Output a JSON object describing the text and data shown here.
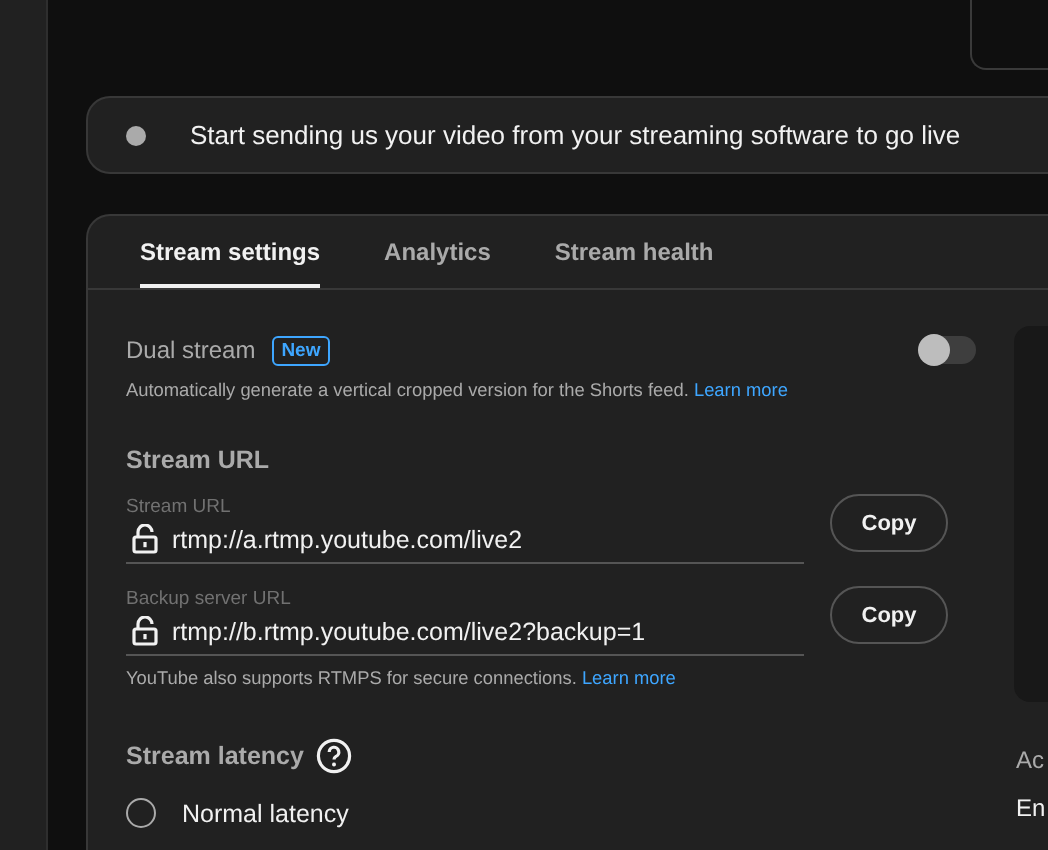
{
  "banner": {
    "text": "Start sending us your video from your streaming software to go live"
  },
  "tabs": [
    {
      "label": "Stream settings",
      "selected": true
    },
    {
      "label": "Analytics",
      "selected": false
    },
    {
      "label": "Stream health",
      "selected": false
    }
  ],
  "dual_stream": {
    "label": "Dual stream",
    "badge": "New",
    "on": false,
    "description": "Automatically generate a vertical cropped version for the Shorts feed.",
    "link": "Learn more"
  },
  "stream_url": {
    "heading": "Stream URL",
    "fields": [
      {
        "label": "Stream URL",
        "value": "rtmp://a.rtmp.youtube.com/live2",
        "button": "Copy"
      },
      {
        "label": "Backup server URL",
        "value": "rtmp://b.rtmp.youtube.com/live2?backup=1",
        "button": "Copy"
      }
    ],
    "note": "YouTube also supports RTMPS for secure connections.",
    "note_link": "Learn more"
  },
  "latency": {
    "heading": "Stream latency",
    "options": [
      {
        "label": "Normal latency",
        "selected": false
      }
    ]
  },
  "side_texts": [
    "Ac",
    "En"
  ]
}
